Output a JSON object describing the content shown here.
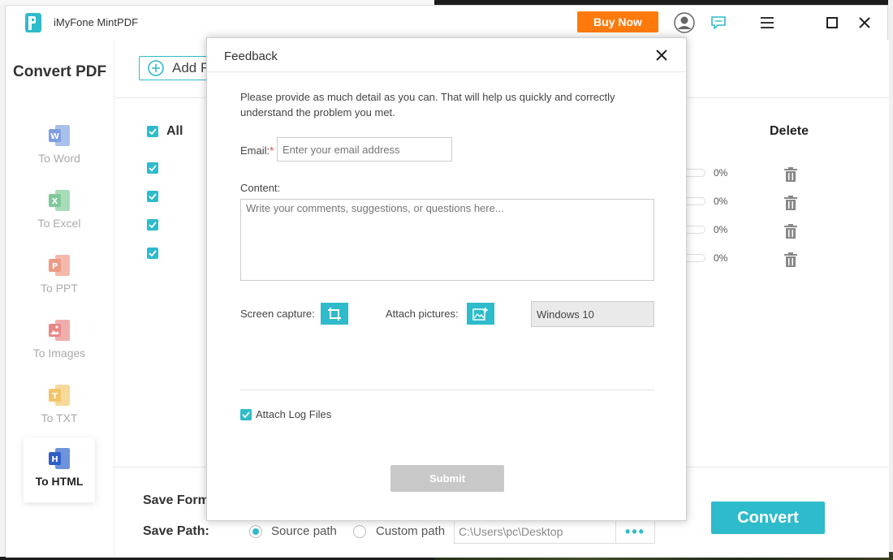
{
  "app": {
    "title": "iMyFone MintPDF",
    "buy_now": "Buy Now"
  },
  "sidebar": {
    "title": "Convert PDF",
    "items": [
      {
        "label": "To Word",
        "letter": "W",
        "color": "#6a8fd8"
      },
      {
        "label": "To Excel",
        "letter": "X",
        "color": "#5cb87a"
      },
      {
        "label": "To PPT",
        "letter": "P",
        "color": "#e5735a"
      },
      {
        "label": "To Images",
        "letter": "",
        "color": "#e06464"
      },
      {
        "label": "To TXT",
        "letter": "T",
        "color": "#f0b43c"
      },
      {
        "label": "To HTML",
        "letter": "H",
        "color": "#2f5fc6"
      }
    ],
    "active": "To HTML"
  },
  "main": {
    "add_label": "Add F",
    "all_label": "All",
    "delete_header": "Delete",
    "rows": [
      {
        "progress": "0%"
      },
      {
        "progress": "0%"
      },
      {
        "progress": "0%"
      },
      {
        "progress": "0%"
      }
    ],
    "save_format_label": "Save Form",
    "save_path_label": "Save Path:",
    "source_path": "Source path",
    "custom_path": "Custom path",
    "path_value": "C:\\Users\\pc\\Desktop",
    "path_dots": "•••",
    "convert": "Convert"
  },
  "feedback": {
    "title": "Feedback",
    "description": "Please provide as much detail as you can. That will help us quickly and correctly understand the problem you met.",
    "email_label": "Email:",
    "email_required": "*",
    "email_placeholder": "Enter your email address",
    "content_label": "Content:",
    "content_placeholder": "Write your comments, suggestions, or questions here...",
    "screen_capture_label": "Screen capture:",
    "attach_pictures_label": "Attach pictures:",
    "os_value": "Windows 10",
    "attach_log_label": "Attach Log Files",
    "submit": "Submit"
  },
  "colors": {
    "accent": "#2ebbcb",
    "buy_now": "#ff7a0c",
    "submit_disabled": "#c8c8c8"
  }
}
